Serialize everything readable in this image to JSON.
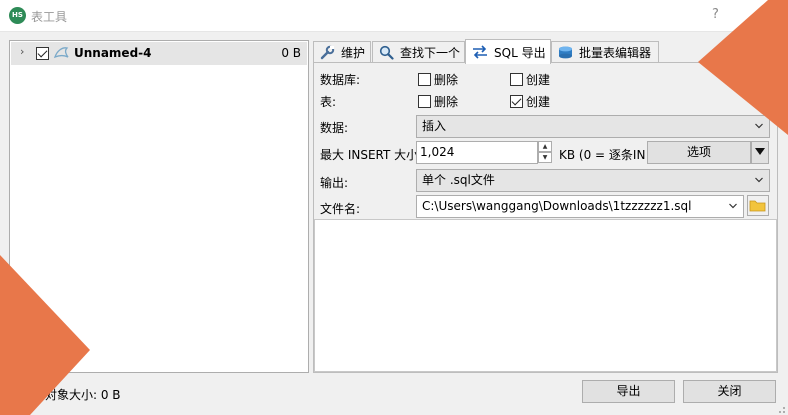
{
  "window": {
    "title": "表工具",
    "app_icon_text": "HS",
    "help_label": "?"
  },
  "tree": {
    "items": [
      {
        "name": "Unnamed-4",
        "size": "0 B",
        "checked": true,
        "expander": "›"
      }
    ]
  },
  "tabs": [
    {
      "label": "维护",
      "icon": "wrench-icon",
      "active": false
    },
    {
      "label": "查找下一个",
      "icon": "magnifier-icon",
      "active": false
    },
    {
      "label": "SQL 导出",
      "icon": "export-arrows-icon",
      "active": true
    },
    {
      "label": "批量表编辑器",
      "icon": "database-icon",
      "active": false
    }
  ],
  "sql_export": {
    "database_label": "数据库:",
    "table_label": "表:",
    "database_drop": {
      "label": "删除",
      "checked": false
    },
    "database_create": {
      "label": "创建",
      "checked": false
    },
    "table_drop": {
      "label": "删除",
      "checked": false
    },
    "table_create": {
      "label": "创建",
      "checked": true
    },
    "data_label": "数据:",
    "data_value": "插入",
    "max_insert_label": "最大 INSERT 大小",
    "max_insert_value": "1,024",
    "kb_hint": "KB (0 = 逐条IN",
    "options_label": "选项",
    "output_label": "输出:",
    "output_value": "单个 .sql文件",
    "filename_label": "文件名:",
    "filename_value": "C:\\Users\\wanggang\\Downloads\\1tzzzzzz1.sql"
  },
  "footer": {
    "status": "的对象大小: 0 B",
    "export_button": "导出",
    "close_button": "关闭"
  },
  "colors": {
    "accent_orange": "#e8774a",
    "app_icon_green": "#2e8b57",
    "folder_yellow": "#f2c43d"
  }
}
